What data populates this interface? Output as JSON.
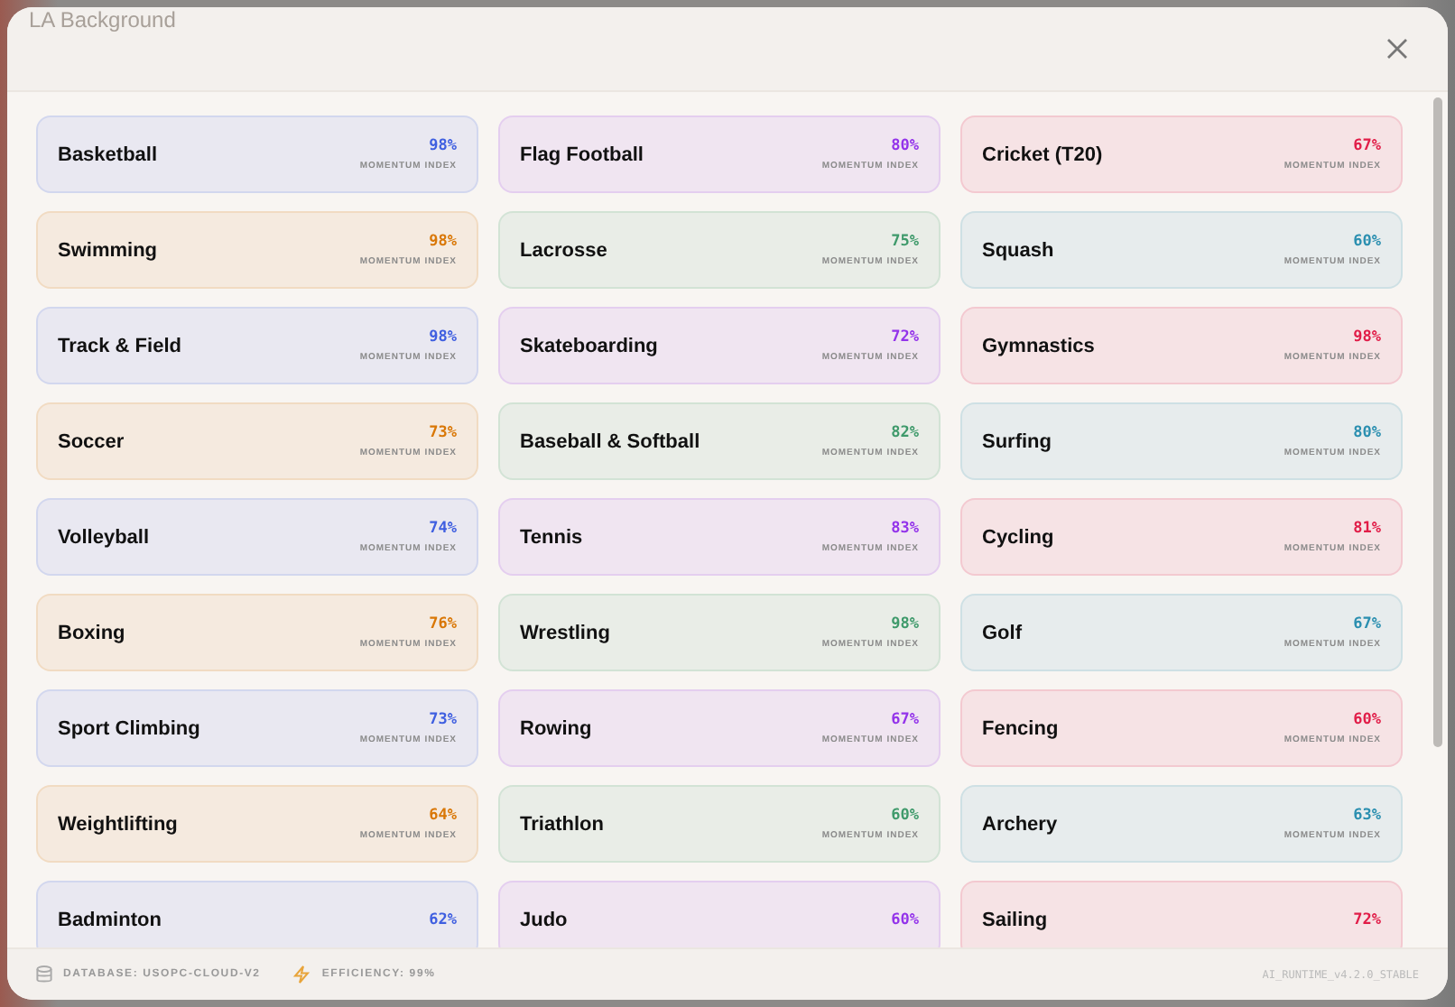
{
  "background_label": "LA Background",
  "cards": [
    {
      "name": "Basketball",
      "value": "98%",
      "subtitle": "MOMENTUM INDEX",
      "color": "#3f5fe0"
    },
    {
      "name": "Flag Football",
      "value": "80%",
      "subtitle": "MOMENTUM INDEX",
      "color": "#9333ea"
    },
    {
      "name": "Cricket (T20)",
      "value": "67%",
      "subtitle": "MOMENTUM INDEX",
      "color": "#e11d48"
    },
    {
      "name": "Swimming",
      "value": "98%",
      "subtitle": "MOMENTUM INDEX",
      "color": "#d97706"
    },
    {
      "name": "Lacrosse",
      "value": "75%",
      "subtitle": "MOMENTUM INDEX",
      "color": "#3f9a6b"
    },
    {
      "name": "Squash",
      "value": "60%",
      "subtitle": "MOMENTUM INDEX",
      "color": "#2b8fb0"
    },
    {
      "name": "Track & Field",
      "value": "98%",
      "subtitle": "MOMENTUM INDEX",
      "color": "#3f5fe0"
    },
    {
      "name": "Skateboarding",
      "value": "72%",
      "subtitle": "MOMENTUM INDEX",
      "color": "#9333ea"
    },
    {
      "name": "Gymnastics",
      "value": "98%",
      "subtitle": "MOMENTUM INDEX",
      "color": "#e11d48"
    },
    {
      "name": "Soccer",
      "value": "73%",
      "subtitle": "MOMENTUM INDEX",
      "color": "#d97706"
    },
    {
      "name": "Baseball & Softball",
      "value": "82%",
      "subtitle": "MOMENTUM INDEX",
      "color": "#3f9a6b"
    },
    {
      "name": "Surfing",
      "value": "80%",
      "subtitle": "MOMENTUM INDEX",
      "color": "#2b8fb0"
    },
    {
      "name": "Volleyball",
      "value": "74%",
      "subtitle": "MOMENTUM INDEX",
      "color": "#3f5fe0"
    },
    {
      "name": "Tennis",
      "value": "83%",
      "subtitle": "MOMENTUM INDEX",
      "color": "#9333ea"
    },
    {
      "name": "Cycling",
      "value": "81%",
      "subtitle": "MOMENTUM INDEX",
      "color": "#e11d48"
    },
    {
      "name": "Boxing",
      "value": "76%",
      "subtitle": "MOMENTUM INDEX",
      "color": "#d97706"
    },
    {
      "name": "Wrestling",
      "value": "98%",
      "subtitle": "MOMENTUM INDEX",
      "color": "#3f9a6b"
    },
    {
      "name": "Golf",
      "value": "67%",
      "subtitle": "MOMENTUM INDEX",
      "color": "#2b8fb0"
    },
    {
      "name": "Sport Climbing",
      "value": "73%",
      "subtitle": "MOMENTUM INDEX",
      "color": "#3f5fe0"
    },
    {
      "name": "Rowing",
      "value": "67%",
      "subtitle": "MOMENTUM INDEX",
      "color": "#9333ea"
    },
    {
      "name": "Fencing",
      "value": "60%",
      "subtitle": "MOMENTUM INDEX",
      "color": "#e11d48"
    },
    {
      "name": "Weightlifting",
      "value": "64%",
      "subtitle": "MOMENTUM INDEX",
      "color": "#d97706"
    },
    {
      "name": "Triathlon",
      "value": "60%",
      "subtitle": "MOMENTUM INDEX",
      "color": "#3f9a6b"
    },
    {
      "name": "Archery",
      "value": "63%",
      "subtitle": "MOMENTUM INDEX",
      "color": "#2b8fb0"
    },
    {
      "name": "Badminton",
      "value": "62%",
      "color": "#3f5fe0"
    },
    {
      "name": "Judo",
      "value": "60%",
      "color": "#9333ea"
    },
    {
      "name": "Sailing",
      "value": "72%",
      "color": "#e11d48"
    }
  ],
  "status_bar": {
    "database": "DATABASE: USOPC-CLOUD-V2",
    "efficiency": "EFFICIENCY: 99%",
    "version": "AI_RUNTIME_v4.2.0_STABLE"
  }
}
